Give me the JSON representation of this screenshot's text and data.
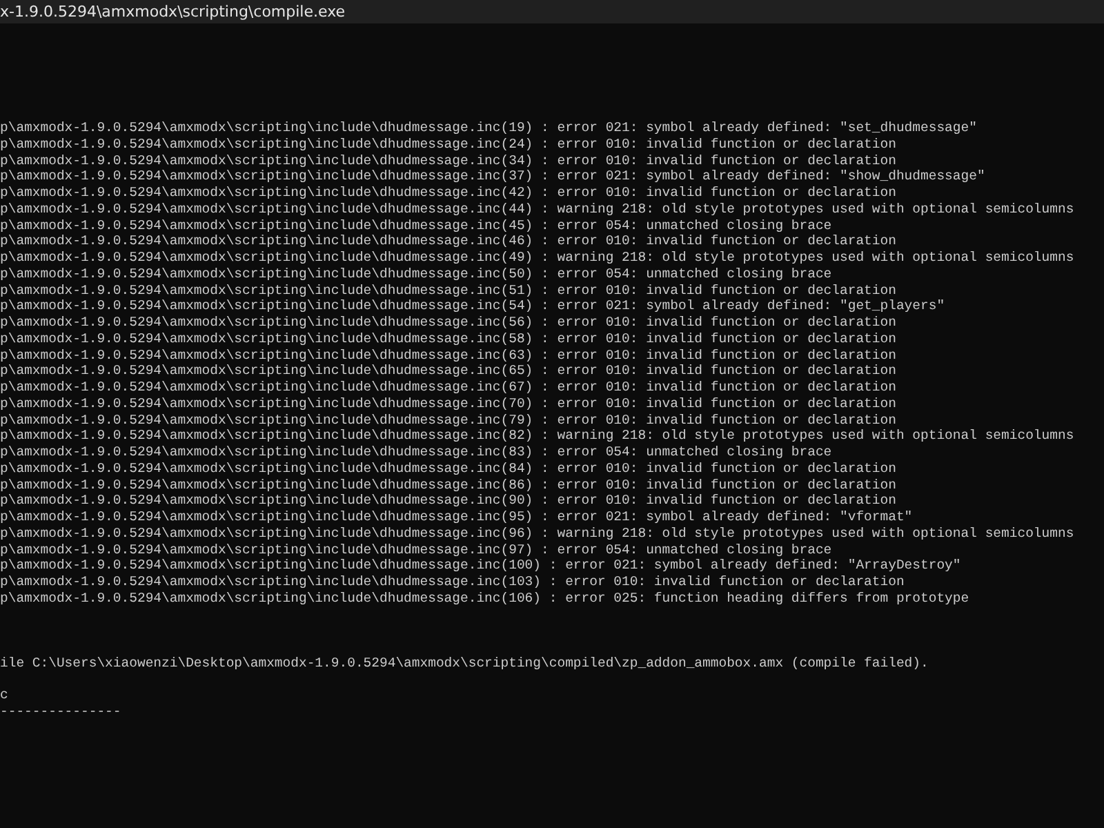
{
  "window": {
    "title": "x-1.9.0.5294\\amxmodx\\scripting\\compile.exe"
  },
  "errors": [
    "p\\amxmodx-1.9.0.5294\\amxmodx\\scripting\\include\\dhudmessage.inc(19) : error 021: symbol already defined: \"set_dhudmessage\"",
    "p\\amxmodx-1.9.0.5294\\amxmodx\\scripting\\include\\dhudmessage.inc(24) : error 010: invalid function or declaration",
    "p\\amxmodx-1.9.0.5294\\amxmodx\\scripting\\include\\dhudmessage.inc(34) : error 010: invalid function or declaration",
    "p\\amxmodx-1.9.0.5294\\amxmodx\\scripting\\include\\dhudmessage.inc(37) : error 021: symbol already defined: \"show_dhudmessage\"",
    "p\\amxmodx-1.9.0.5294\\amxmodx\\scripting\\include\\dhudmessage.inc(42) : error 010: invalid function or declaration",
    "p\\amxmodx-1.9.0.5294\\amxmodx\\scripting\\include\\dhudmessage.inc(44) : warning 218: old style prototypes used with optional semicolumns",
    "p\\amxmodx-1.9.0.5294\\amxmodx\\scripting\\include\\dhudmessage.inc(45) : error 054: unmatched closing brace",
    "p\\amxmodx-1.9.0.5294\\amxmodx\\scripting\\include\\dhudmessage.inc(46) : error 010: invalid function or declaration",
    "p\\amxmodx-1.9.0.5294\\amxmodx\\scripting\\include\\dhudmessage.inc(49) : warning 218: old style prototypes used with optional semicolumns",
    "p\\amxmodx-1.9.0.5294\\amxmodx\\scripting\\include\\dhudmessage.inc(50) : error 054: unmatched closing brace",
    "p\\amxmodx-1.9.0.5294\\amxmodx\\scripting\\include\\dhudmessage.inc(51) : error 010: invalid function or declaration",
    "p\\amxmodx-1.9.0.5294\\amxmodx\\scripting\\include\\dhudmessage.inc(54) : error 021: symbol already defined: \"get_players\"",
    "p\\amxmodx-1.9.0.5294\\amxmodx\\scripting\\include\\dhudmessage.inc(56) : error 010: invalid function or declaration",
    "p\\amxmodx-1.9.0.5294\\amxmodx\\scripting\\include\\dhudmessage.inc(58) : error 010: invalid function or declaration",
    "p\\amxmodx-1.9.0.5294\\amxmodx\\scripting\\include\\dhudmessage.inc(63) : error 010: invalid function or declaration",
    "p\\amxmodx-1.9.0.5294\\amxmodx\\scripting\\include\\dhudmessage.inc(65) : error 010: invalid function or declaration",
    "p\\amxmodx-1.9.0.5294\\amxmodx\\scripting\\include\\dhudmessage.inc(67) : error 010: invalid function or declaration",
    "p\\amxmodx-1.9.0.5294\\amxmodx\\scripting\\include\\dhudmessage.inc(70) : error 010: invalid function or declaration",
    "p\\amxmodx-1.9.0.5294\\amxmodx\\scripting\\include\\dhudmessage.inc(79) : error 010: invalid function or declaration",
    "p\\amxmodx-1.9.0.5294\\amxmodx\\scripting\\include\\dhudmessage.inc(82) : warning 218: old style prototypes used with optional semicolumns",
    "p\\amxmodx-1.9.0.5294\\amxmodx\\scripting\\include\\dhudmessage.inc(83) : error 054: unmatched closing brace",
    "p\\amxmodx-1.9.0.5294\\amxmodx\\scripting\\include\\dhudmessage.inc(84) : error 010: invalid function or declaration",
    "p\\amxmodx-1.9.0.5294\\amxmodx\\scripting\\include\\dhudmessage.inc(86) : error 010: invalid function or declaration",
    "p\\amxmodx-1.9.0.5294\\amxmodx\\scripting\\include\\dhudmessage.inc(90) : error 010: invalid function or declaration",
    "p\\amxmodx-1.9.0.5294\\amxmodx\\scripting\\include\\dhudmessage.inc(95) : error 021: symbol already defined: \"vformat\"",
    "p\\amxmodx-1.9.0.5294\\amxmodx\\scripting\\include\\dhudmessage.inc(96) : warning 218: old style prototypes used with optional semicolumns",
    "p\\amxmodx-1.9.0.5294\\amxmodx\\scripting\\include\\dhudmessage.inc(97) : error 054: unmatched closing brace",
    "p\\amxmodx-1.9.0.5294\\amxmodx\\scripting\\include\\dhudmessage.inc(100) : error 021: symbol already defined: \"ArrayDestroy\"",
    "p\\amxmodx-1.9.0.5294\\amxmodx\\scripting\\include\\dhudmessage.inc(103) : error 010: invalid function or declaration",
    "p\\amxmodx-1.9.0.5294\\amxmodx\\scripting\\include\\dhudmessage.inc(106) : error 025: function heading differs from prototype"
  ],
  "result": "ile C:\\Users\\xiaowenzi\\Desktop\\amxmodx-1.9.0.5294\\amxmodx\\scripting\\compiled\\zp_addon_ammobox.amx (compile failed).",
  "prompt_lines": [
    "c",
    "---------------"
  ]
}
